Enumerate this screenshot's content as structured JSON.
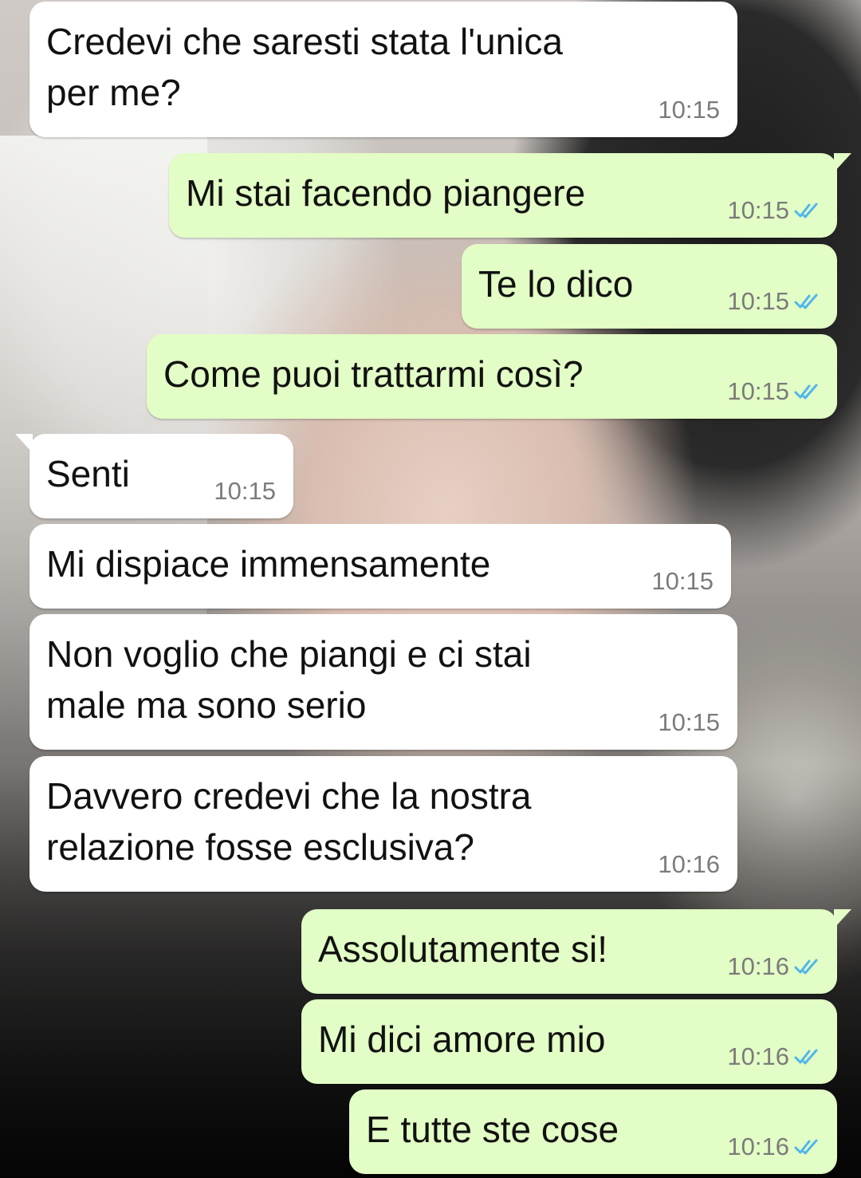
{
  "messages": [
    {
      "direction": "in",
      "text": "Credevi che saresti stata l'unica\nper me?",
      "time": "10:15"
    },
    {
      "direction": "out",
      "text": "Mi stai facendo piangere",
      "time": "10:15",
      "status": "read"
    },
    {
      "direction": "out",
      "text": "Te lo dico",
      "time": "10:15",
      "status": "read"
    },
    {
      "direction": "out",
      "text": "Come puoi trattarmi così?",
      "time": "10:15",
      "status": "read"
    },
    {
      "direction": "in",
      "text": "Senti",
      "time": "10:15"
    },
    {
      "direction": "in",
      "text": "Mi dispiace immensamente",
      "time": "10:15"
    },
    {
      "direction": "in",
      "text": "Non voglio che piangi e ci stai\nmale ma sono serio",
      "time": "10:15"
    },
    {
      "direction": "in",
      "text": "Davvero credevi che la nostra\nrelazione fosse esclusiva?",
      "time": "10:16"
    },
    {
      "direction": "out",
      "text": "Assolutamente si!",
      "time": "10:16",
      "status": "read"
    },
    {
      "direction": "out",
      "text": "Mi dici amore mio",
      "time": "10:16",
      "status": "read"
    },
    {
      "direction": "out",
      "text": "E tutte ste cose",
      "time": "10:16",
      "status": "read"
    }
  ],
  "colors": {
    "incoming_bubble": "#ffffff",
    "outgoing_bubble": "#e2fdc5",
    "read_ticks": "#4fb6ec",
    "timestamp": "#7b7b7b"
  },
  "icons": {
    "read_status": "double-check-icon"
  }
}
